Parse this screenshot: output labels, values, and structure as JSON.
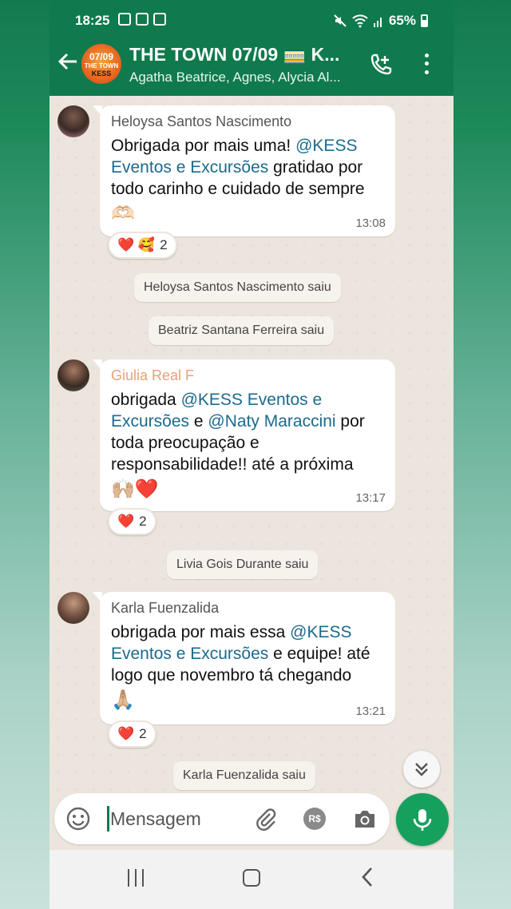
{
  "status_bar": {
    "time": "18:25",
    "battery": "65%",
    "icons": [
      "gallery-icon",
      "check-icon",
      "tv-icon",
      "mute-icon",
      "wifi-icon",
      "signal-icon",
      "battery-icon"
    ]
  },
  "header": {
    "title": "THE TOWN 07/09 🚃 K...",
    "subtitle": "Agatha Beatrice, Agnes, Alycia Al...",
    "avatar_line1": "07/09",
    "avatar_line2": "THE TOWN",
    "avatar_line3": "KESS"
  },
  "messages": [
    {
      "sender": "Heloysa Santos Nascimento",
      "text_before": "Obrigada por mais uma! ",
      "mention": "@KESS Eventos e Excursões",
      "text_after": " gratidao por todo carinho e cuidado de sempre",
      "emoji": "🫶🏻",
      "time": "13:08",
      "reactions": {
        "emojis": "❤️ 🥰",
        "count": "2"
      }
    },
    {
      "sender": "Giulia Real F",
      "text_before": "obrigada ",
      "mention": "@KESS Eventos e Excursões",
      "text_mid": " e ",
      "mention2": "@Naty Maraccini",
      "text_after": " por toda preocupação e responsabilidade!! até a próxima",
      "emoji": "🙌🏼❤️",
      "time": "13:17",
      "reactions": {
        "emojis": "❤️",
        "count": "2"
      }
    },
    {
      "sender": "Karla Fuenzalida",
      "text_before": "obrigada por mais essa ",
      "mention": "@KESS Eventos e Excursões",
      "text_after": " e equipe! até logo que novembro tá chegando",
      "emoji": "🙏🏼",
      "time": "13:21",
      "reactions": {
        "emojis": "❤️",
        "count": "2"
      }
    }
  ],
  "system": [
    "Heloysa Santos Nascimento saiu",
    "Beatriz Santana Ferreira saiu",
    "Livia Gois Durante saiu",
    "Karla Fuenzalida saiu"
  ],
  "input": {
    "placeholder": "Mensagem"
  },
  "pay_label": "R$",
  "colors": {
    "header": "#0f7a4c",
    "mention": "#1b6a8d",
    "mic": "#16a05d"
  }
}
